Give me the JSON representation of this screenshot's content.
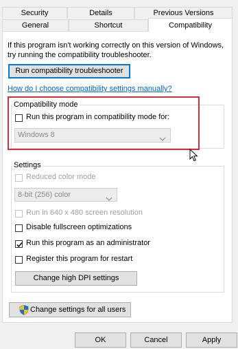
{
  "tabs": {
    "row1": [
      "Security",
      "Details",
      "Previous Versions"
    ],
    "row2": [
      "General",
      "Shortcut",
      "Compatibility"
    ]
  },
  "intro": {
    "line1": "If this program isn't working correctly on this version of Windows,",
    "line2": "try running the compatibility troubleshooter."
  },
  "troubleshooter_button": "Run compatibility troubleshooter",
  "help_link": "How do I choose compatibility settings manually?",
  "compat_mode": {
    "title": "Compatibility mode",
    "checkbox_label": "Run this program in compatibility mode for:",
    "checked": false,
    "select_value": "Windows 8"
  },
  "settings": {
    "title": "Settings",
    "reduced_color_label": "Reduced color mode",
    "color_select_value": "8-bit (256) color",
    "resolution_label": "Run in 640 x 480 screen resolution",
    "fullscreen_label": "Disable fullscreen optimizations",
    "admin_label": "Run this program as an administrator",
    "restart_label": "Register this program for restart",
    "dpi_button": "Change high DPI settings",
    "admin_checked": true
  },
  "all_users_button": "Change settings for all users",
  "footer": {
    "ok": "OK",
    "cancel": "Cancel",
    "apply": "Apply"
  },
  "colors": {
    "highlight_box": "#d32f3a",
    "accent": "#0078d7",
    "link": "#0066cc"
  }
}
